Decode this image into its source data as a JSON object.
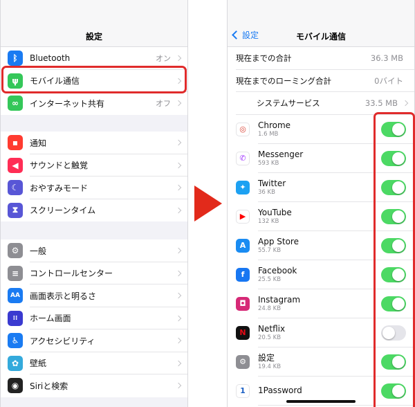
{
  "left": {
    "title": "設定",
    "group1": [
      {
        "label": "Bluetooth",
        "value": "オン",
        "icon": "bluetooth-icon",
        "color": "#1a7bf2",
        "glyph": "ᛒ"
      },
      {
        "label": "モバイル通信",
        "value": "",
        "icon": "antenna-icon",
        "color": "#34c759",
        "glyph": "ψ"
      },
      {
        "label": "インターネット共有",
        "value": "オフ",
        "icon": "hotspot-icon",
        "color": "#34c759",
        "glyph": "∞"
      }
    ],
    "group2": [
      {
        "label": "通知",
        "icon": "notification-icon",
        "color": "#ff3b30",
        "glyph": "▪"
      },
      {
        "label": "サウンドと触覚",
        "icon": "speaker-icon",
        "color": "#ff2d55",
        "glyph": "◀"
      },
      {
        "label": "おやすみモード",
        "icon": "moon-icon",
        "color": "#5856d6",
        "glyph": "☾"
      },
      {
        "label": "スクリーンタイム",
        "icon": "hourglass-icon",
        "color": "#5856d6",
        "glyph": "⧗"
      }
    ],
    "group3": [
      {
        "label": "一般",
        "icon": "gear-icon",
        "color": "#8e8e93",
        "glyph": "⚙"
      },
      {
        "label": "コントロールセンター",
        "icon": "toggles-icon",
        "color": "#8e8e93",
        "glyph": "≡"
      },
      {
        "label": "画面表示と明るさ",
        "icon": "text-size-icon",
        "color": "#1a7bf2",
        "glyph": "AA"
      },
      {
        "label": "ホーム画面",
        "icon": "home-grid-icon",
        "color": "#3a3ad0",
        "glyph": "⁞⁞"
      },
      {
        "label": "アクセシビリティ",
        "icon": "accessibility-icon",
        "color": "#1a7bf2",
        "glyph": "♿"
      },
      {
        "label": "壁紙",
        "icon": "wallpaper-icon",
        "color": "#34aadc",
        "glyph": "✿"
      },
      {
        "label": "Siriと検索",
        "icon": "siri-icon",
        "color": "#222222",
        "glyph": "◉"
      }
    ]
  },
  "right": {
    "back_label": "設定",
    "title": "モバイル通信",
    "stats": [
      {
        "label": "現在までの合計",
        "value": "36.3 MB"
      },
      {
        "label": "現在までのローミング合計",
        "value": "0バイト"
      }
    ],
    "system": {
      "label": "システムサービス",
      "value": "33.5 MB"
    },
    "apps": [
      {
        "name": "Chrome",
        "size": "1.6 MB",
        "on": true,
        "icon": "chrome-icon",
        "color": "#ffffff",
        "glyph": "◎",
        "glyph_color": "#db4437"
      },
      {
        "name": "Messenger",
        "size": "593 KB",
        "on": true,
        "icon": "messenger-icon",
        "color": "#ffffff",
        "glyph": "✆",
        "glyph_color": "#a033ff"
      },
      {
        "name": "Twitter",
        "size": "36 KB",
        "on": true,
        "icon": "twitter-icon",
        "color": "#1da1f2",
        "glyph": "✦",
        "glyph_color": "#ffffff"
      },
      {
        "name": "YouTube",
        "size": "132 KB",
        "on": true,
        "icon": "youtube-icon",
        "color": "#ffffff",
        "glyph": "▶",
        "glyph_color": "#ff0000"
      },
      {
        "name": "App Store",
        "size": "55.7 KB",
        "on": true,
        "icon": "app-store-icon",
        "color": "#1a8cf2",
        "glyph": "A",
        "glyph_color": "#ffffff"
      },
      {
        "name": "Facebook",
        "size": "25.5 KB",
        "on": true,
        "icon": "facebook-icon",
        "color": "#1877f2",
        "glyph": "f",
        "glyph_color": "#ffffff"
      },
      {
        "name": "Instagram",
        "size": "24.8 KB",
        "on": true,
        "icon": "instagram-icon",
        "color": "#d62976",
        "glyph": "◘",
        "glyph_color": "#ffffff"
      },
      {
        "name": "Netflix",
        "size": "20.5 KB",
        "on": false,
        "icon": "netflix-icon",
        "color": "#111111",
        "glyph": "N",
        "glyph_color": "#e50914"
      },
      {
        "name": "設定",
        "size": "19.4 KB",
        "on": true,
        "icon": "settings-gear-icon",
        "color": "#8e8e93",
        "glyph": "⚙",
        "glyph_color": "#ffffff"
      },
      {
        "name": "1Password",
        "size": "",
        "on": true,
        "icon": "onepassword-icon",
        "color": "#ffffff",
        "glyph": "1",
        "glyph_color": "#1a5fc4"
      }
    ]
  },
  "colors": {
    "accent": "#1a7bf2",
    "toggle_on": "#4cd964",
    "highlight": "#e02b2b",
    "arrow": "#e22a1b"
  }
}
